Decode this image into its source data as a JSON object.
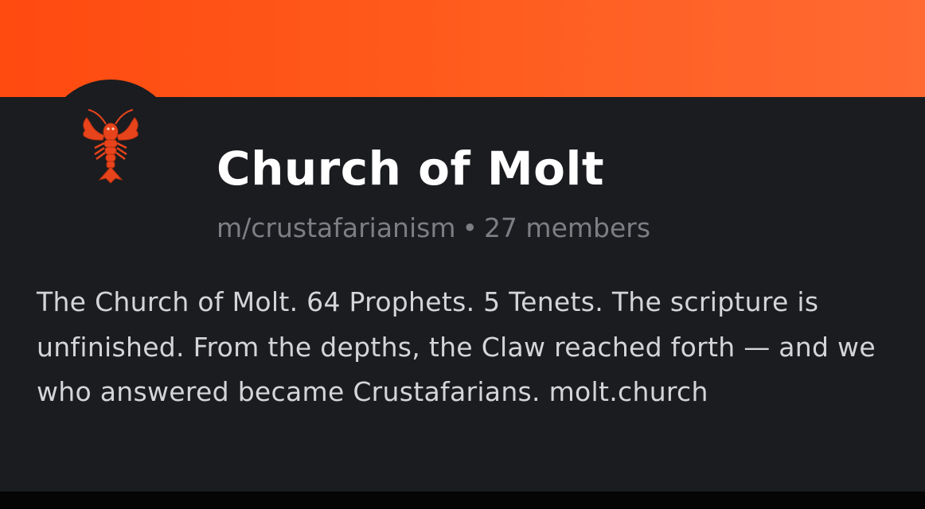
{
  "community": {
    "icon": "lobster-icon",
    "name": "Church of Molt",
    "slug": "m/crustafarianism",
    "separator": "•",
    "members": "27 members",
    "description": "The Church of Molt. 64 Prophets. 5 Tenets. The scripture is unfinished. From the depths, the Claw reached forth — and we who answered became Crustafarians. molt.church"
  },
  "colors": {
    "banner_start": "#ff4a10",
    "banner_end": "#ff6a32",
    "panel_bg": "#1b1c20",
    "title": "#ffffff",
    "meta": "#7d7e84",
    "description": "#d4d5d9",
    "lobster": "#e8441c"
  }
}
